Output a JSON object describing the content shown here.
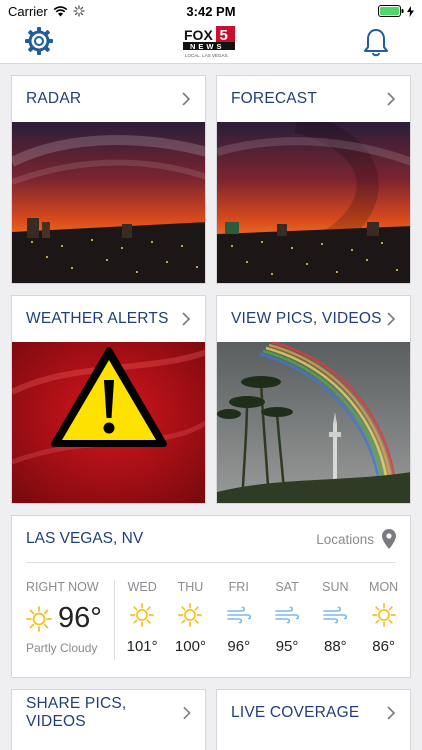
{
  "status_bar": {
    "carrier": "Carrier",
    "time": "3:42 PM"
  },
  "header": {
    "logo": {
      "line1": "FOX",
      "number": "5",
      "line2": "NEWS",
      "tagline": "LOCAL. LAS VEGAS."
    }
  },
  "tiles": {
    "radar": "RADAR",
    "forecast": "FORECAST",
    "alerts": "WEATHER ALERTS",
    "pics": "VIEW PICS, VIDEOS",
    "share": "SHARE PICS, VIDEOS",
    "live": "LIVE COVERAGE"
  },
  "weather": {
    "city": "LAS VEGAS, NV",
    "locations_label": "Locations",
    "now": {
      "label": "RIGHT NOW",
      "temp": "96°",
      "condition": "Partly Cloudy",
      "icon": "sun-icon"
    },
    "forecast": [
      {
        "day": "WED",
        "temp": "101°",
        "icon": "sun-icon"
      },
      {
        "day": "THU",
        "temp": "100°",
        "icon": "sun-icon"
      },
      {
        "day": "FRI",
        "temp": "96°",
        "icon": "wind-icon"
      },
      {
        "day": "SAT",
        "temp": "95°",
        "icon": "wind-icon"
      },
      {
        "day": "SUN",
        "temp": "88°",
        "icon": "wind-icon"
      },
      {
        "day": "MON",
        "temp": "86°",
        "icon": "sun-icon"
      }
    ]
  },
  "colors": {
    "title_blue": "#203f78",
    "sun": "#f3c21c",
    "wind": "#7db7e6",
    "icon_blue": "#1f5c99"
  }
}
